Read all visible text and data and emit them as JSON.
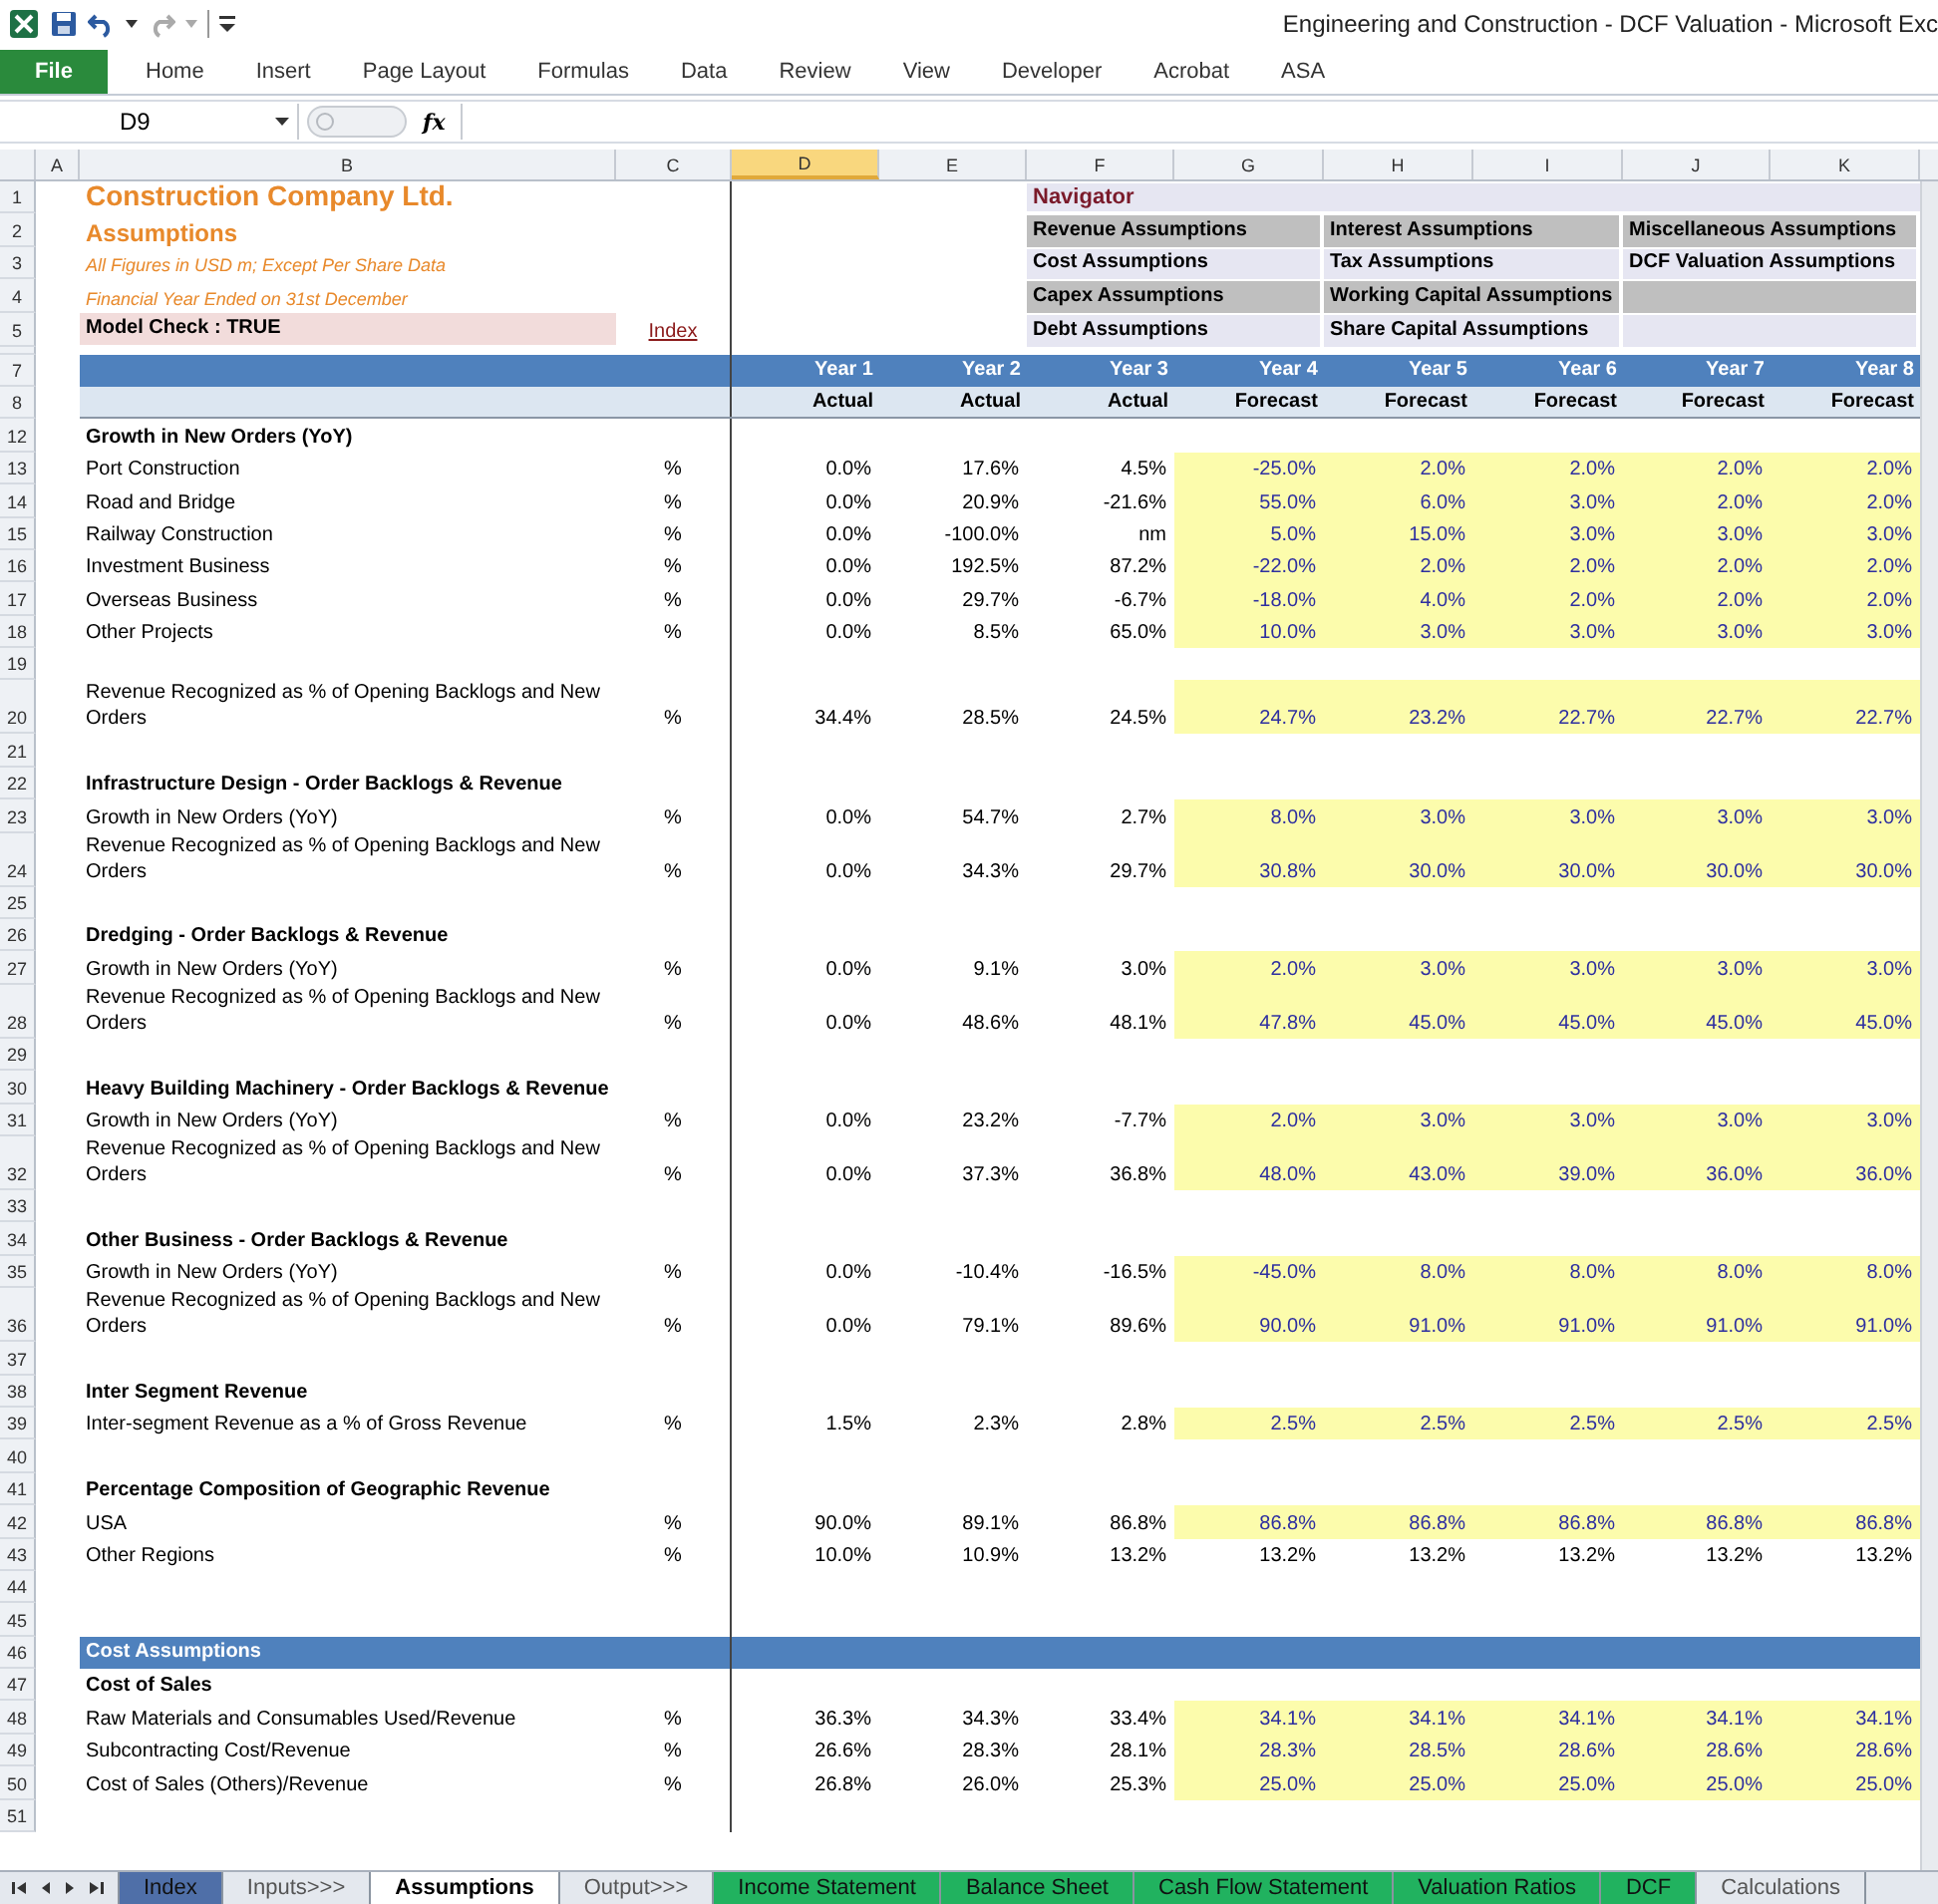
{
  "window": {
    "title": "Engineering and Construction - DCF Valuation  -  Microsoft Exc"
  },
  "ribbon_tabs": [
    {
      "label": "File",
      "kind": "file"
    },
    {
      "label": "Home",
      "kind": "tab"
    },
    {
      "label": "Insert",
      "kind": "tab"
    },
    {
      "label": "Page Layout",
      "kind": "tab"
    },
    {
      "label": "Formulas",
      "kind": "tab"
    },
    {
      "label": "Data",
      "kind": "tab"
    },
    {
      "label": "Review",
      "kind": "tab"
    },
    {
      "label": "View",
      "kind": "tab"
    },
    {
      "label": "Developer",
      "kind": "tab"
    },
    {
      "label": "Acrobat",
      "kind": "tab"
    },
    {
      "label": "ASA",
      "kind": "tab"
    }
  ],
  "formula_bar": {
    "name_box": "D9",
    "function_label": "fx"
  },
  "columns": [
    {
      "label": "A",
      "selected": false
    },
    {
      "label": "B",
      "selected": false
    },
    {
      "label": "C",
      "selected": false
    },
    {
      "label": "D",
      "selected": true
    },
    {
      "label": "E",
      "selected": false
    },
    {
      "label": "F",
      "selected": false
    },
    {
      "label": "G",
      "selected": false
    },
    {
      "label": "H",
      "selected": false
    },
    {
      "label": "I",
      "selected": false
    },
    {
      "label": "J",
      "selected": false
    },
    {
      "label": "K",
      "selected": false
    }
  ],
  "navigator": {
    "title": "Navigator",
    "rows": [
      {
        "shaded": true,
        "links": [
          "Revenue Assumptions",
          "Interest Assumptions",
          "Miscellaneous Assumptions"
        ]
      },
      {
        "shaded": false,
        "links": [
          "Cost Assumptions",
          "Tax Assumptions",
          "DCF Valuation Assumptions"
        ]
      },
      {
        "shaded": true,
        "links": [
          "Capex Assumptions",
          "Working Capital Assumptions"
        ]
      },
      {
        "shaded": false,
        "links": [
          "Debt Assumptions",
          "Share Capital Assumptions"
        ]
      }
    ]
  },
  "rows": [
    {
      "num": "1",
      "kind": "title",
      "text": "Construction Company Ltd."
    },
    {
      "num": "2",
      "kind": "subtitle",
      "text": "Assumptions"
    },
    {
      "num": "3",
      "kind": "note",
      "text": "All Figures in USD m; Except Per Share Data"
    },
    {
      "num": "4",
      "kind": "note",
      "text": "Financial Year Ended on 31st December"
    },
    {
      "num": "5",
      "kind": "check",
      "text": "Model Check : TRUE",
      "link": "Index"
    },
    {
      "kind": "spacer"
    },
    {
      "num": "7",
      "kind": "years",
      "cells": [
        "Year 1",
        "Year 2",
        "Year 3",
        "Year 4",
        "Year 5",
        "Year 6",
        "Year 7",
        "Year 8"
      ]
    },
    {
      "num": "8",
      "kind": "status",
      "cells": [
        "Actual",
        "Actual",
        "Actual",
        "Forecast",
        "Forecast",
        "Forecast",
        "Forecast",
        "Forecast"
      ]
    },
    {
      "num": "12",
      "kind": "section",
      "text": "Growth in New Orders (YoY)"
    },
    {
      "num": "13",
      "kind": "data",
      "text": "Port Construction",
      "unit": "%",
      "input": true,
      "values": [
        "0.0%",
        "17.6%",
        "4.5%",
        "-25.0%",
        "2.0%",
        "2.0%",
        "2.0%",
        "2.0%"
      ]
    },
    {
      "num": "14",
      "kind": "data",
      "text": "Road and Bridge",
      "unit": "%",
      "input": true,
      "values": [
        "0.0%",
        "20.9%",
        "-21.6%",
        "55.0%",
        "6.0%",
        "3.0%",
        "2.0%",
        "2.0%"
      ]
    },
    {
      "num": "15",
      "kind": "data",
      "text": "Railway Construction",
      "unit": "%",
      "input": true,
      "values": [
        "0.0%",
        "-100.0%",
        "nm",
        "5.0%",
        "15.0%",
        "3.0%",
        "3.0%",
        "3.0%"
      ]
    },
    {
      "num": "16",
      "kind": "data",
      "text": "Investment Business",
      "unit": "%",
      "input": true,
      "values": [
        "0.0%",
        "192.5%",
        "87.2%",
        "-22.0%",
        "2.0%",
        "2.0%",
        "2.0%",
        "2.0%"
      ]
    },
    {
      "num": "17",
      "kind": "data",
      "text": "Overseas Business",
      "unit": "%",
      "input": true,
      "values": [
        "0.0%",
        "29.7%",
        "-6.7%",
        "-18.0%",
        "4.0%",
        "2.0%",
        "2.0%",
        "2.0%"
      ]
    },
    {
      "num": "18",
      "kind": "data",
      "text": "Other Projects",
      "unit": "%",
      "input": true,
      "values": [
        "0.0%",
        "8.5%",
        "65.0%",
        "10.0%",
        "3.0%",
        "3.0%",
        "3.0%",
        "3.0%"
      ]
    },
    {
      "num": "19",
      "kind": "blank"
    },
    {
      "num": "20",
      "kind": "data",
      "text": "Revenue Recognized as % of Opening Backlogs and New Orders",
      "unit": "%",
      "input": true,
      "values": [
        "34.4%",
        "28.5%",
        "24.5%",
        "24.7%",
        "23.2%",
        "22.7%",
        "22.7%",
        "22.7%"
      ]
    },
    {
      "num": "21",
      "kind": "blank"
    },
    {
      "num": "22",
      "kind": "section",
      "text": "Infrastructure Design - Order Backlogs & Revenue"
    },
    {
      "num": "23",
      "kind": "data",
      "text": "Growth in New Orders (YoY)",
      "unit": "%",
      "input": true,
      "values": [
        "0.0%",
        "54.7%",
        "2.7%",
        "8.0%",
        "3.0%",
        "3.0%",
        "3.0%",
        "3.0%"
      ]
    },
    {
      "num": "24",
      "kind": "data",
      "text": "Revenue Recognized as % of Opening Backlogs and New Orders",
      "unit": "%",
      "input": true,
      "values": [
        "0.0%",
        "34.3%",
        "29.7%",
        "30.8%",
        "30.0%",
        "30.0%",
        "30.0%",
        "30.0%"
      ]
    },
    {
      "num": "25",
      "kind": "blank"
    },
    {
      "num": "26",
      "kind": "section",
      "text": "Dredging - Order Backlogs & Revenue"
    },
    {
      "num": "27",
      "kind": "data",
      "text": "Growth in New Orders (YoY)",
      "unit": "%",
      "input": true,
      "values": [
        "0.0%",
        "9.1%",
        "3.0%",
        "2.0%",
        "3.0%",
        "3.0%",
        "3.0%",
        "3.0%"
      ]
    },
    {
      "num": "28",
      "kind": "data",
      "text": "Revenue Recognized as % of Opening Backlogs and New Orders",
      "unit": "%",
      "input": true,
      "values": [
        "0.0%",
        "48.6%",
        "48.1%",
        "47.8%",
        "45.0%",
        "45.0%",
        "45.0%",
        "45.0%"
      ]
    },
    {
      "num": "29",
      "kind": "blank"
    },
    {
      "num": "30",
      "kind": "section",
      "text": "Heavy Building Machinery - Order Backlogs & Revenue"
    },
    {
      "num": "31",
      "kind": "data",
      "text": "Growth in New Orders (YoY)",
      "unit": "%",
      "input": true,
      "values": [
        "0.0%",
        "23.2%",
        "-7.7%",
        "2.0%",
        "3.0%",
        "3.0%",
        "3.0%",
        "3.0%"
      ]
    },
    {
      "num": "32",
      "kind": "data",
      "text": "Revenue Recognized as % of Opening Backlogs and New Orders",
      "unit": "%",
      "input": true,
      "values": [
        "0.0%",
        "37.3%",
        "36.8%",
        "48.0%",
        "43.0%",
        "39.0%",
        "36.0%",
        "36.0%"
      ]
    },
    {
      "num": "33",
      "kind": "blank"
    },
    {
      "num": "34",
      "kind": "section",
      "text": "Other Business - Order Backlogs & Revenue"
    },
    {
      "num": "35",
      "kind": "data",
      "text": "Growth in New Orders (YoY)",
      "unit": "%",
      "input": true,
      "values": [
        "0.0%",
        "-10.4%",
        "-16.5%",
        "-45.0%",
        "8.0%",
        "8.0%",
        "8.0%",
        "8.0%"
      ]
    },
    {
      "num": "36",
      "kind": "data",
      "text": "Revenue Recognized as % of Opening Backlogs and New Orders",
      "unit": "%",
      "input": true,
      "values": [
        "0.0%",
        "79.1%",
        "89.6%",
        "90.0%",
        "91.0%",
        "91.0%",
        "91.0%",
        "91.0%"
      ]
    },
    {
      "num": "37",
      "kind": "blank"
    },
    {
      "num": "38",
      "kind": "section",
      "text": "Inter Segment Revenue"
    },
    {
      "num": "39",
      "kind": "data",
      "text": "Inter-segment Revenue as a % of Gross Revenue",
      "unit": "%",
      "input": true,
      "values": [
        "1.5%",
        "2.3%",
        "2.8%",
        "2.5%",
        "2.5%",
        "2.5%",
        "2.5%",
        "2.5%"
      ]
    },
    {
      "num": "40",
      "kind": "blank"
    },
    {
      "num": "41",
      "kind": "section",
      "text": "Percentage Composition of Geographic Revenue"
    },
    {
      "num": "42",
      "kind": "data",
      "text": "USA",
      "unit": "%",
      "input": true,
      "values": [
        "90.0%",
        "89.1%",
        "86.8%",
        "86.8%",
        "86.8%",
        "86.8%",
        "86.8%",
        "86.8%"
      ]
    },
    {
      "num": "43",
      "kind": "data",
      "text": "Other Regions",
      "unit": "%",
      "input": false,
      "values": [
        "10.0%",
        "10.9%",
        "13.2%",
        "13.2%",
        "13.2%",
        "13.2%",
        "13.2%",
        "13.2%"
      ]
    },
    {
      "num": "44",
      "kind": "blank"
    },
    {
      "num": "45",
      "kind": "blank"
    },
    {
      "num": "46",
      "kind": "band",
      "text": "Cost Assumptions"
    },
    {
      "num": "47",
      "kind": "section",
      "text": "Cost of Sales"
    },
    {
      "num": "48",
      "kind": "data",
      "text": "Raw Materials and Consumables Used/Revenue",
      "unit": "%",
      "input": true,
      "values": [
        "36.3%",
        "34.3%",
        "33.4%",
        "34.1%",
        "34.1%",
        "34.1%",
        "34.1%",
        "34.1%"
      ]
    },
    {
      "num": "49",
      "kind": "data",
      "text": "Subcontracting Cost/Revenue",
      "unit": "%",
      "input": true,
      "values": [
        "26.6%",
        "28.3%",
        "28.1%",
        "28.3%",
        "28.5%",
        "28.6%",
        "28.6%",
        "28.6%"
      ]
    },
    {
      "num": "50",
      "kind": "data",
      "text": "Cost of Sales (Others)/Revenue",
      "unit": "%",
      "input": true,
      "values": [
        "26.8%",
        "26.0%",
        "25.3%",
        "25.0%",
        "25.0%",
        "25.0%",
        "25.0%",
        "25.0%"
      ]
    },
    {
      "num": "51",
      "kind": "blank"
    }
  ],
  "sheet_tabs": [
    {
      "label": "Index",
      "selected": false,
      "color": "#4f6fa8"
    },
    {
      "label": "Inputs>>>",
      "selected": false
    },
    {
      "label": "Assumptions",
      "selected": true
    },
    {
      "label": "Output>>>",
      "selected": false
    },
    {
      "label": "Income Statement",
      "selected": false,
      "color": "#21b25f"
    },
    {
      "label": "Balance Sheet",
      "selected": false,
      "color": "#21b25f"
    },
    {
      "label": "Cash Flow Statement",
      "selected": false,
      "color": "#21b25f"
    },
    {
      "label": "Valuation Ratios",
      "selected": false,
      "color": "#21b25f"
    },
    {
      "label": "DCF",
      "selected": false,
      "color": "#21b25f"
    },
    {
      "label": "Calculations",
      "selected": false
    }
  ]
}
